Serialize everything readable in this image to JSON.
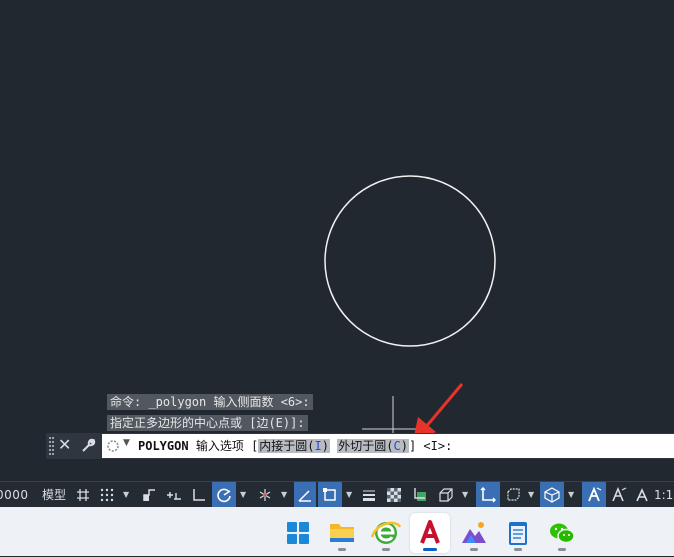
{
  "history": [
    {
      "text": "命令: _polygon 输入侧面数 <6>:"
    },
    {
      "text": "指定正多边形的中心点或 [边(E)]:"
    }
  ],
  "command": {
    "keyword": "POLYGON",
    "prompt": "输入选项",
    "bracket_open": "[",
    "option1_text": "内接于圆(",
    "option1_key": "I",
    "option1_close": ")",
    "option2_text": "外切于圆(",
    "option2_key": "C",
    "option2_close": ")",
    "bracket_close": "]",
    "default": "<I>:"
  },
  "status": {
    "scale_value": "0000",
    "model_label": "模型",
    "annotation_scale": "1:1"
  },
  "colors": {
    "canvas_bg": "#212830",
    "accent_blue": "#3b6fb3",
    "arrow_red": "#e8332a",
    "circle": "#ffffff"
  },
  "taskbar": {
    "apps": [
      "windows-start",
      "file-explorer",
      "browser",
      "autocad",
      "paint-app",
      "notepad",
      "wechat"
    ],
    "active": "autocad"
  }
}
